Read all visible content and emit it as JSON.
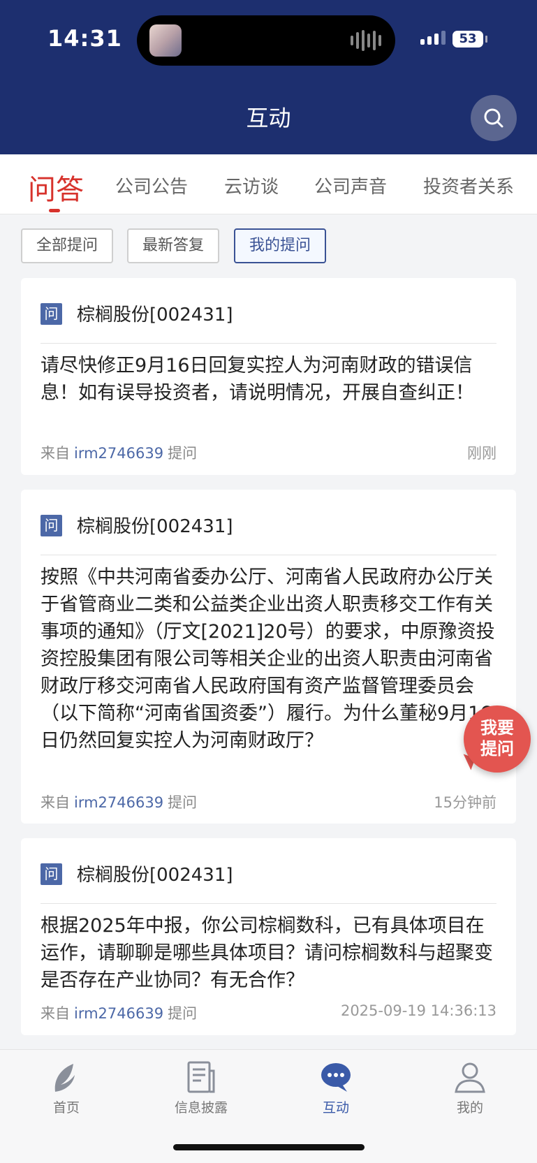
{
  "status_bar": {
    "time": "14:31",
    "battery": "53"
  },
  "header": {
    "title": "互动"
  },
  "tabs": [
    {
      "label": "问答",
      "active": true
    },
    {
      "label": "公司公告"
    },
    {
      "label": "云访谈"
    },
    {
      "label": "公司声音"
    },
    {
      "label": "投资者关系"
    }
  ],
  "filters": [
    {
      "label": "全部提问"
    },
    {
      "label": "最新答复"
    },
    {
      "label": "我的提问",
      "active": true
    }
  ],
  "posts": [
    {
      "badge": "问",
      "company": "棕榈股份[002431]",
      "question": "请尽快修正9月16日回复实控人为河南财政的错误信息！如有误导投资者，请说明情况，开展自查纠正！",
      "from_label": "来自",
      "user": "irm2746639",
      "action_label": "提问",
      "time": "刚刚"
    },
    {
      "badge": "问",
      "company": "棕榈股份[002431]",
      "question": "按照《中共河南省委办公厅、河南省人民政府办公厅关于省管商业二类和公益类企业出资人职责移交工作有关事项的通知》（厅文[2021]20号）的要求，中原豫资投资控股集团有限公司等相关企业的出资人职责由河南省财政厅移交河南省人民政府国有资产监督管理委员会（以下简称“河南省国资委”）履行。为什么董秘9月16日仍然回复实控人为河南财政厅？",
      "from_label": "来自",
      "user": "irm2746639",
      "action_label": "提问",
      "time": "15分钟前"
    },
    {
      "badge": "问",
      "company": "棕榈股份[002431]",
      "question": "根据2025年中报，你公司棕榈数科，已有具体项目在运作，请聊聊是哪些具体项目？请问棕榈数科与超聚变是否存在产业协同？有无合作？",
      "from_label": "来自",
      "user": "irm2746639",
      "action_label": "提问",
      "time": "2025-09-19 14:36:13"
    }
  ],
  "fab": {
    "line1": "我要",
    "line2": "提问"
  },
  "bottom_nav": [
    {
      "label": "首页",
      "icon": "leaf-icon"
    },
    {
      "label": "信息披露",
      "icon": "document-icon"
    },
    {
      "label": "互动",
      "icon": "chat-bubble-icon",
      "active": true
    },
    {
      "label": "我的",
      "icon": "person-icon"
    }
  ],
  "colors": {
    "header_bg": "#1d2f6f",
    "accent_red": "#d7322c",
    "link_blue": "#4c68a7",
    "active_nav": "#3a5aa8"
  }
}
